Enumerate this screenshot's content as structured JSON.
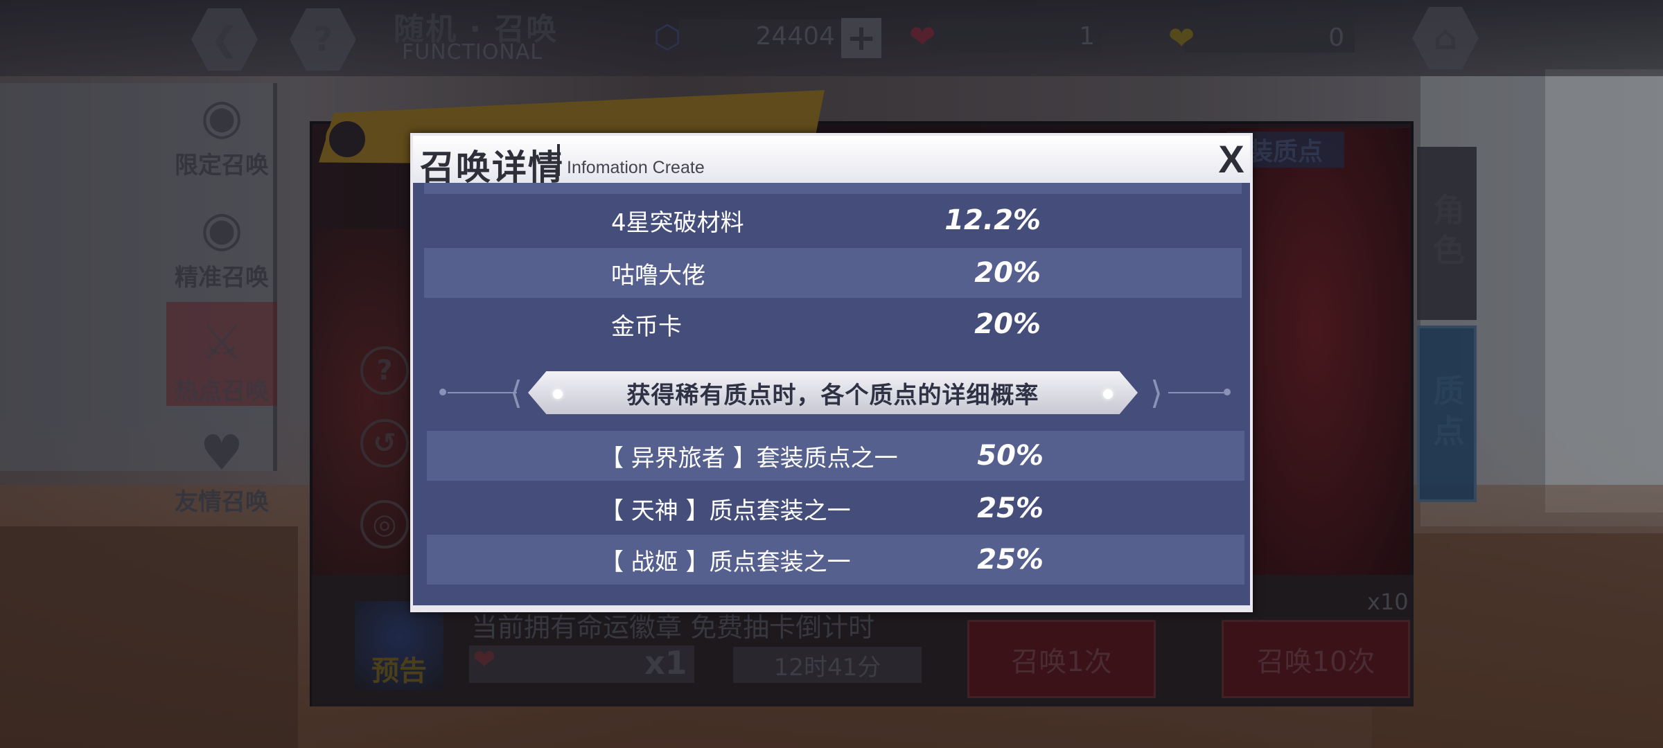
{
  "top_bar": {
    "back_icon": "back-arrow-icon",
    "help_icon": "question-icon",
    "title_cn": "随机 · 召唤",
    "title_en": "FUNCTIONAL",
    "resources": [
      {
        "icon": "crystal-icon",
        "value": "24404"
      },
      {
        "icon": "heart-badge-icon",
        "value": "1"
      },
      {
        "icon": "gold-heart-icon",
        "value": "0"
      }
    ],
    "home_icon": "home-icon"
  },
  "left_menu": {
    "items": [
      {
        "label": "限定召唤",
        "icon": "eye-icon"
      },
      {
        "label": "精准召唤",
        "icon": "eye-icon"
      },
      {
        "label": "热点召唤",
        "icon": "sword-icon",
        "active": true
      },
      {
        "label": "友情召唤",
        "icon": "heart-icon"
      }
    ]
  },
  "back_panel": {
    "tag": "装质点",
    "side_tabs": [
      "角色",
      "质点"
    ],
    "notice_label": "预告",
    "info_line": "当前拥有命运徽章   免费抽卡倒计时",
    "ticket_count": "x1",
    "timer": "12时41分",
    "multiplier": "x10",
    "summon_once": "召唤1次",
    "summon_ten": "召唤10次"
  },
  "modal": {
    "title": "召唤详情",
    "subtitle": "Infomation Create",
    "close_label": "X",
    "rows_top": [
      {
        "label": "4星突破材料",
        "value": "12.2%"
      },
      {
        "label": "咕噜大佬",
        "value": "20%"
      },
      {
        "label": "金币卡",
        "value": "20%"
      }
    ],
    "section_title": "获得稀有质点时，各个质点的详细概率",
    "rows_bottom": [
      {
        "label": "【 异界旅者 】套装质点之一",
        "value": "50%"
      },
      {
        "label": "【 天神 】质点套装之一",
        "value": "25%"
      },
      {
        "label": "【 战姬 】质点套装之一",
        "value": "25%"
      }
    ]
  }
}
